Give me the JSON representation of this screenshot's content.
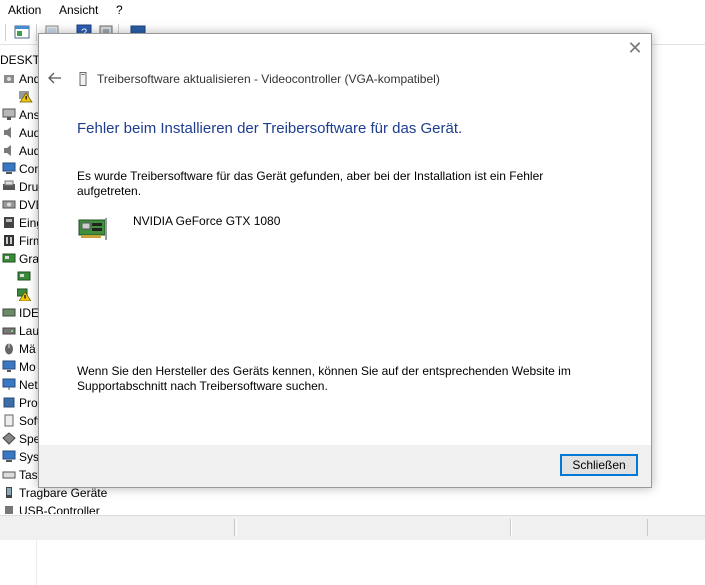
{
  "menu": {
    "items": [
      "Aktion",
      "Ansicht",
      "?"
    ]
  },
  "tree": {
    "root": "DESKTO",
    "items": [
      {
        "label": "And",
        "icon": "audio-input-icon"
      },
      {
        "label": "",
        "icon": "warning-device-icon"
      },
      {
        "label": "Ans",
        "icon": "monitor-adapter-icon"
      },
      {
        "label": "Aud",
        "icon": "speaker-icon"
      },
      {
        "label": "Aud",
        "icon": "speaker-icon"
      },
      {
        "label": "Com",
        "icon": "computer-icon"
      },
      {
        "label": "Dru",
        "icon": "printer-icon"
      },
      {
        "label": "DVD",
        "icon": "disc-drive-icon"
      },
      {
        "label": "Eing",
        "icon": "hid-icon"
      },
      {
        "label": "Firm",
        "icon": "firmware-icon"
      },
      {
        "label": "Gra",
        "icon": "display-adapter-icon"
      },
      {
        "label": "",
        "icon": "gpu-icon"
      },
      {
        "label": "",
        "icon": "gpu-warning-icon"
      },
      {
        "label": "IDE",
        "icon": "ide-icon"
      },
      {
        "label": "Lau",
        "icon": "drive-icon"
      },
      {
        "label": "Mä",
        "icon": "mouse-icon"
      },
      {
        "label": "Mo",
        "icon": "monitor-icon"
      },
      {
        "label": "Net",
        "icon": "network-icon"
      },
      {
        "label": "Pro",
        "icon": "processor-icon"
      },
      {
        "label": "Soft",
        "icon": "software-icon"
      },
      {
        "label": "Spe",
        "icon": "storage-icon"
      },
      {
        "label": "Syst",
        "icon": "system-icon"
      },
      {
        "label": "Tast",
        "icon": "keyboard-icon"
      }
    ],
    "bottom_items": [
      "Tragbare Geräte",
      "USB-Controller"
    ]
  },
  "dialog": {
    "title": "Treibersoftware aktualisieren - Videocontroller (VGA-kompatibel)",
    "heading": "Fehler beim Installieren der Treibersoftware für das Gerät.",
    "message": "Es wurde Treibersoftware für das Gerät gefunden, aber bei der Installation ist ein Fehler aufgetreten.",
    "device_name": "NVIDIA GeForce GTX 1080",
    "hint": "Wenn Sie den Hersteller des Geräts kennen, können Sie auf der entsprechenden Website im Supportabschnitt nach Treibersoftware suchen.",
    "close_button": "Schließen",
    "close_glyph": "✕"
  },
  "colors": {
    "heading": "#1e3d8f",
    "accent": "#0078d7",
    "footer": "#f0f0f0"
  }
}
